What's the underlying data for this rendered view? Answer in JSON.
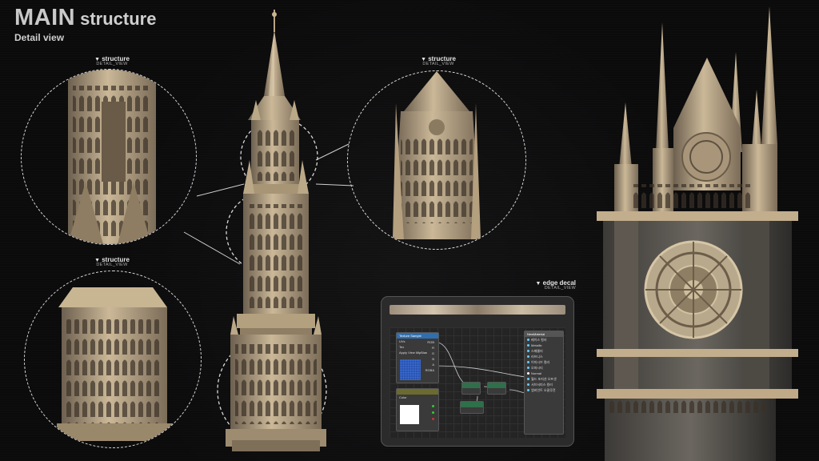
{
  "header": {
    "title_main": "MAIN",
    "title_rest": "structure",
    "subtitle": "Detail view"
  },
  "callouts": [
    {
      "name": "structure",
      "tag": "DETAIL_VIEW"
    },
    {
      "name": "structure",
      "tag": "DETAIL_VIEW"
    },
    {
      "name": "structure",
      "tag": "DETAIL_VIEW"
    },
    {
      "name": "edge decal",
      "tag": "DETAIL_VIEW"
    }
  ],
  "marker": "▼",
  "editor": {
    "texture_node": {
      "title": "Texture Sample",
      "rows": [
        "UVs",
        "Tex",
        "Apply View MipBias"
      ],
      "outs": [
        "RGB",
        "R",
        "G",
        "B",
        "A",
        "RGBA"
      ]
    },
    "color_node": {
      "title": "",
      "rows": [
        "Color"
      ]
    },
    "output_node": {
      "title": "NewMaterial",
      "rows": [
        "베이스 컬러",
        "Metallic",
        "스페큘러",
        "러프니스",
        "이미시브 컬러",
        "오파시티",
        "Normal",
        "월드 포지션 오프셋",
        "서브서피스 컬러",
        "앰비언트 오클루전"
      ]
    }
  },
  "colors": {
    "accent": "#6aa7e0",
    "texture_header": "#2f6fb0",
    "stone": "#bfae94"
  }
}
